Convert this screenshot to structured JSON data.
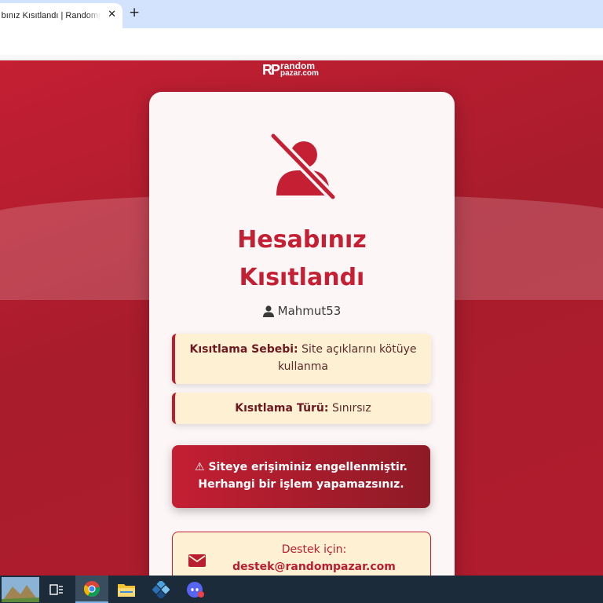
{
  "browser": {
    "tab_title": "Hesabınız Kısıtlandı | Randompazar",
    "close_glyph": "✕",
    "new_tab_glyph": "+"
  },
  "logo": {
    "mark": "RP",
    "line1": "random",
    "line2": "pazar.com"
  },
  "card": {
    "title": "Hesabınız Kısıtlandı",
    "username": "Mahmut53",
    "reason_label": "Kısıtlama Sebebi:",
    "reason_value": "Site açıklarını kötüye kullanma",
    "type_label": "Kısıtlama Türü:",
    "type_value": "Sınırsız",
    "alert_line1": "Siteye erişiminiz engellenmiştir.",
    "alert_line2": "Herhangi bir işlem yapamazsınız.",
    "warning_glyph": "⚠",
    "support_label": "Destek için:",
    "support_email": "destek@randompazar.com"
  },
  "colors": {
    "brand": "#c41f33",
    "info_bg": "#fef1d3"
  },
  "icons": [
    "user-slash-icon",
    "user-icon",
    "warning-icon",
    "mail-icon",
    "chrome-icon",
    "file-explorer-icon",
    "discord-icon"
  ]
}
